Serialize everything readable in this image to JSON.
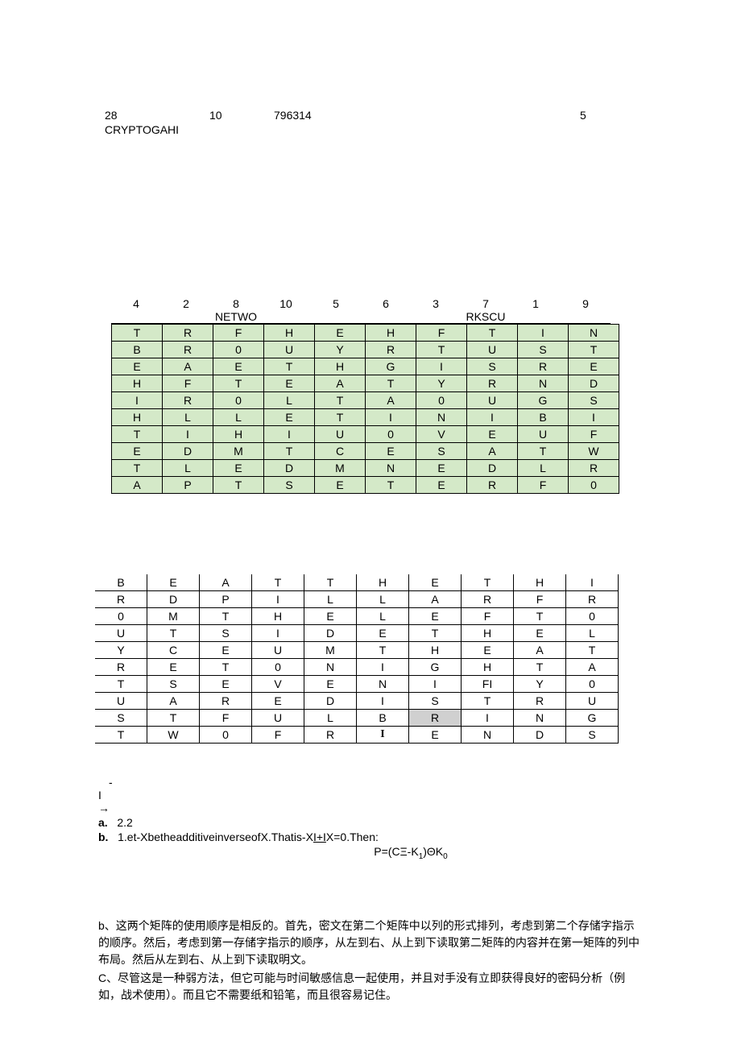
{
  "header": {
    "n28": "28",
    "n10": "10",
    "n79": "796314",
    "n5": "5",
    "cryp": "CRYPTOGAHI"
  },
  "cols_num": [
    "4",
    "2",
    "8",
    "10",
    "5",
    "6",
    "3",
    "7",
    "1",
    "9"
  ],
  "netwo": [
    "",
    "",
    "NETWO",
    "",
    "",
    "",
    "",
    "RKSCU",
    "",
    ""
  ],
  "green_rows": [
    [
      "T",
      "R",
      "F",
      "H",
      "E",
      "H",
      "F",
      "T",
      "I",
      "N"
    ],
    [
      "B",
      "R",
      "0",
      "U",
      "Y",
      "R",
      "T",
      "U",
      "S",
      "T"
    ],
    [
      "E",
      "A",
      "E",
      "T",
      "H",
      "G",
      "I",
      "S",
      "R",
      "E"
    ],
    [
      "H",
      "F",
      "T",
      "E",
      "A",
      "T",
      "Y",
      "R",
      "N",
      "D"
    ],
    [
      "I",
      "R",
      "0",
      "L",
      "T",
      "A",
      "0",
      "U",
      "G",
      "S"
    ],
    [
      "H",
      "L",
      "L",
      "E",
      "T",
      "I",
      "N",
      "I",
      "B",
      "I"
    ],
    [
      "T",
      "I",
      "H",
      "I",
      "U",
      "0",
      "V",
      "E",
      "U",
      "F"
    ],
    [
      "E",
      "D",
      "M",
      "T",
      "C",
      "E",
      "S",
      "A",
      "T",
      "W"
    ],
    [
      "T",
      "L",
      "E",
      "D",
      "M",
      "N",
      "E",
      "D",
      "L",
      "R"
    ],
    [
      "A",
      "P",
      "T",
      "S",
      "E",
      "T",
      "E",
      "R",
      "F",
      "0"
    ]
  ],
  "plain_rows": [
    [
      "B",
      "E",
      "A",
      "T",
      "T",
      "H",
      "E",
      "T",
      "H",
      "I"
    ],
    [
      "R",
      "D",
      "P",
      "I",
      "L",
      "L",
      "A",
      "R",
      "F",
      "R"
    ],
    [
      "0",
      "M",
      "T",
      "H",
      "E",
      "L",
      "E",
      "F",
      "T",
      "0"
    ],
    [
      "U",
      "T",
      "S",
      "I",
      "D",
      "E",
      "T",
      "H",
      "E",
      "L"
    ],
    [
      "Y",
      "C",
      "E",
      "U",
      "M",
      "T",
      "H",
      "E",
      "A",
      "T"
    ],
    [
      "R",
      "E",
      "T",
      "0",
      "N",
      "I",
      "G",
      "H",
      "T",
      "A"
    ],
    [
      "T",
      "S",
      "E",
      "V",
      "E",
      "N",
      "I",
      "FI",
      "Y",
      "0"
    ],
    [
      "U",
      "A",
      "R",
      "E",
      "D",
      "I",
      "S",
      "T",
      "R",
      "U"
    ],
    [
      "S",
      "T",
      "F",
      "U",
      "L",
      "B",
      "R",
      "I",
      "N",
      "G"
    ],
    [
      "T",
      "W",
      "0",
      "F",
      "R",
      "I",
      "E",
      "N",
      "D",
      "S"
    ]
  ],
  "shaded_cell": {
    "row": 8,
    "col": 6
  },
  "bold_cell": {
    "row": 9,
    "col": 5
  },
  "dash": "-",
  "iline": "I",
  "arrow": "→",
  "a_label": "a.",
  "a_text": "2.2",
  "b_label": "b.",
  "b_text": "1.et-XbetheadditiveinverseofX.Thatis-X",
  "b_text2": "I+I",
  "b_text3": "X=0.Then:",
  "formula_p": "P=(CΞ-K",
  "formula_1": "1",
  "formula_mid": ")ΘK",
  "formula_0": "0",
  "ch_b": "b、这两个矩阵的使用顺序是相反的。首先，密文在第二个矩阵中以列的形式排列，考虑到第二个存储字指示的顺序。然后，考虑到第一存储字指示的顺序，从左到右、从上到下读取第二矩阵的内容并在第一矩阵的列中布局。然后从左到右、从上到下读取明文。",
  "ch_c": "C、尽管这是一种弱方法，但它可能与时间敏感信息一起使用，并且对手没有立即获得良好的密码分析（例如，战术使用）。而且它不需要纸和铅笔，而且很容易记住。"
}
